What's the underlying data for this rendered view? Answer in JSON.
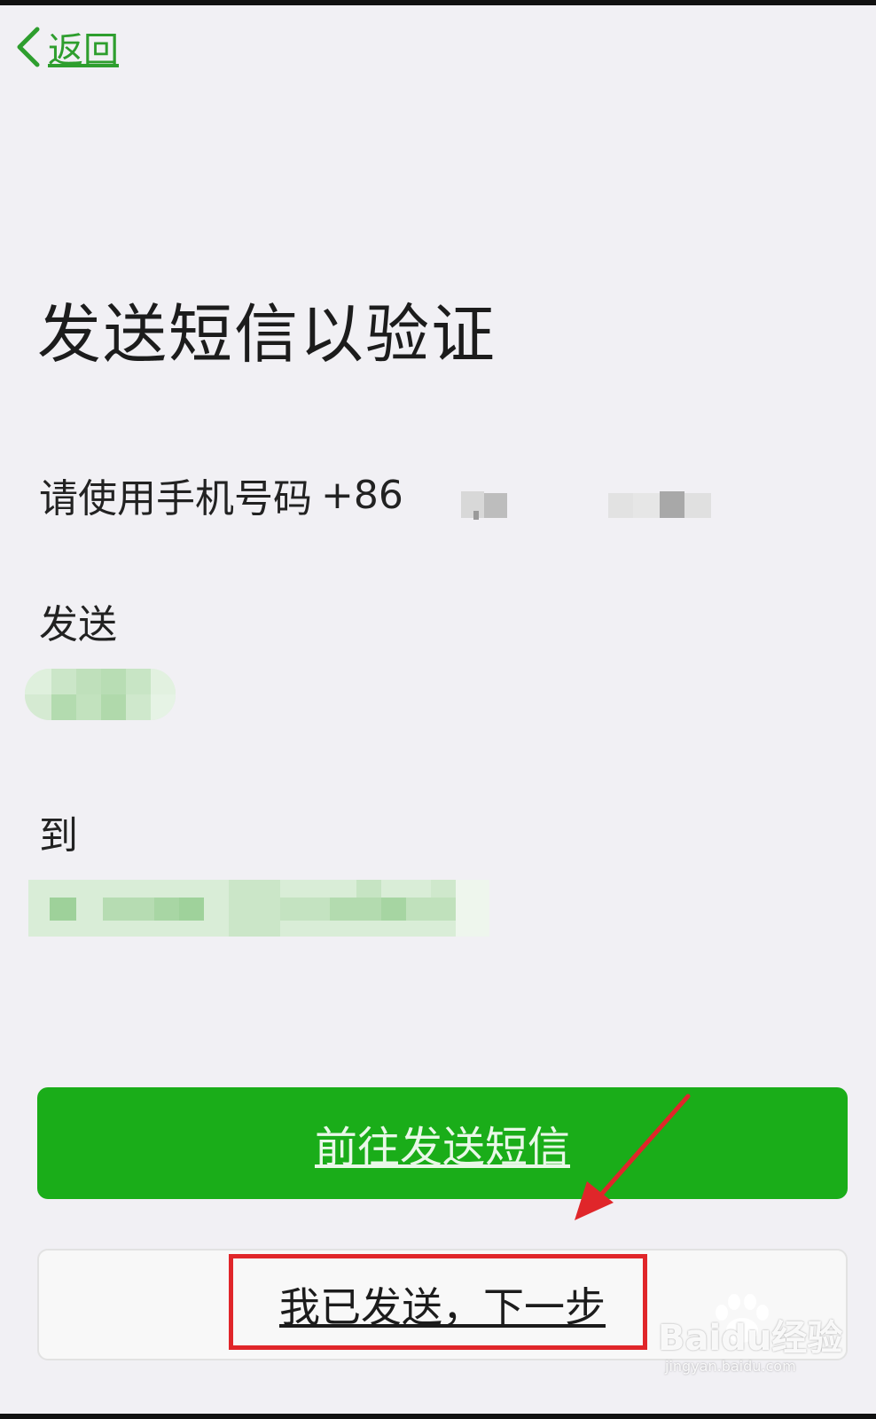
{
  "nav": {
    "back_label": "返回"
  },
  "page": {
    "title": "发送短信以验证",
    "instruction": "请使用手机号码",
    "country_code": "+86",
    "send_label": "发送",
    "to_label": "到"
  },
  "actions": {
    "go_send_sms": "前往发送短信",
    "sent_next": "我已发送，下一步"
  },
  "watermark": {
    "brand": "Baidu经验",
    "url": "jingyan.baidu.com"
  },
  "colors": {
    "accent_green": "#1aad19",
    "link_green": "#2e9e2e",
    "highlight_red": "#e0262a",
    "background": "#f1f0f4"
  }
}
